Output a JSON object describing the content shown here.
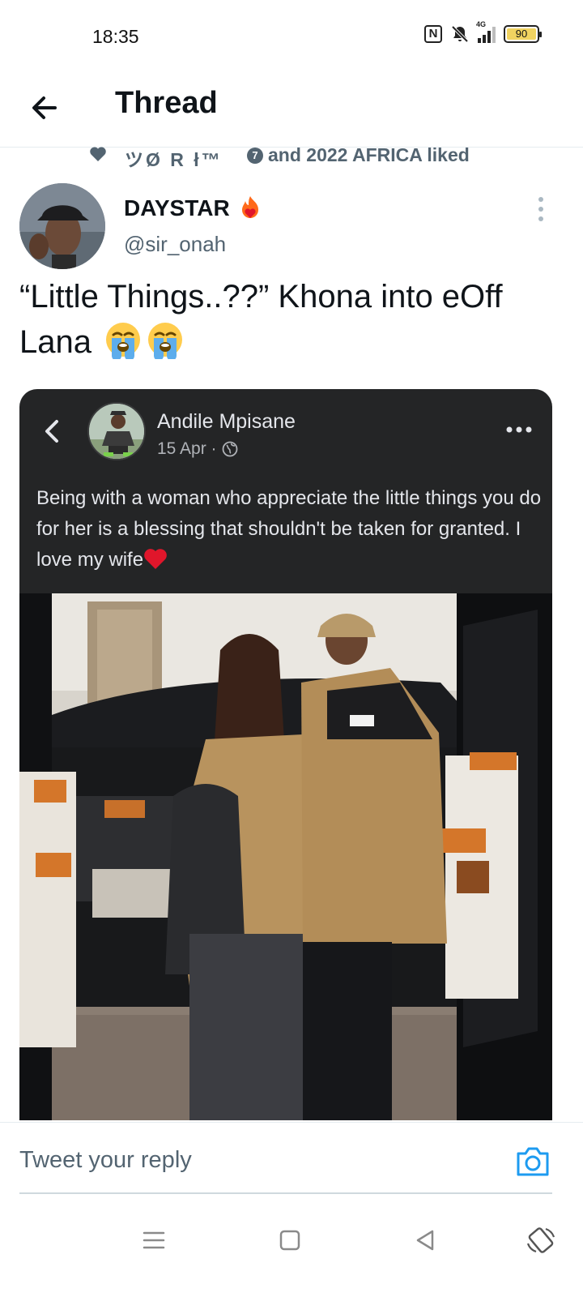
{
  "status_bar": {
    "time": "18:35",
    "nfc_label": "N",
    "network_label": "4G",
    "battery_level": "90"
  },
  "header": {
    "title": "Thread"
  },
  "social_context": {
    "liker_name": "ツØ R ł™",
    "count": "7",
    "text": "and 2022 AFRICA liked"
  },
  "tweet": {
    "author_name": "DAYSTAR",
    "author_handle": "@sir_onah",
    "text": "“Little Things..??” Khona into eOff Lana"
  },
  "embedded_post": {
    "author_name": "Andile Mpisane",
    "date": "15 Apr ·",
    "text": "Being with a woman who appreciate the little things you do for her is a blessing that shouldn't be taken for granted. I love my wife"
  },
  "reply_bar": {
    "placeholder": "Tweet your reply"
  },
  "colors": {
    "text_primary": "#0f1419",
    "text_secondary": "#536471",
    "accent": "#1d9bf0",
    "embed_background": "#242526"
  },
  "icons": [
    "back-arrow-icon",
    "heart-icon",
    "fire-heart-icon",
    "crying-emoji-icon",
    "more-vertical-icon",
    "chevron-left-icon",
    "globe-icon",
    "more-horizontal-icon",
    "red-heart-icon",
    "camera-icon",
    "menu-icon",
    "home-icon",
    "back-triangle-icon",
    "rotate-icon"
  ]
}
